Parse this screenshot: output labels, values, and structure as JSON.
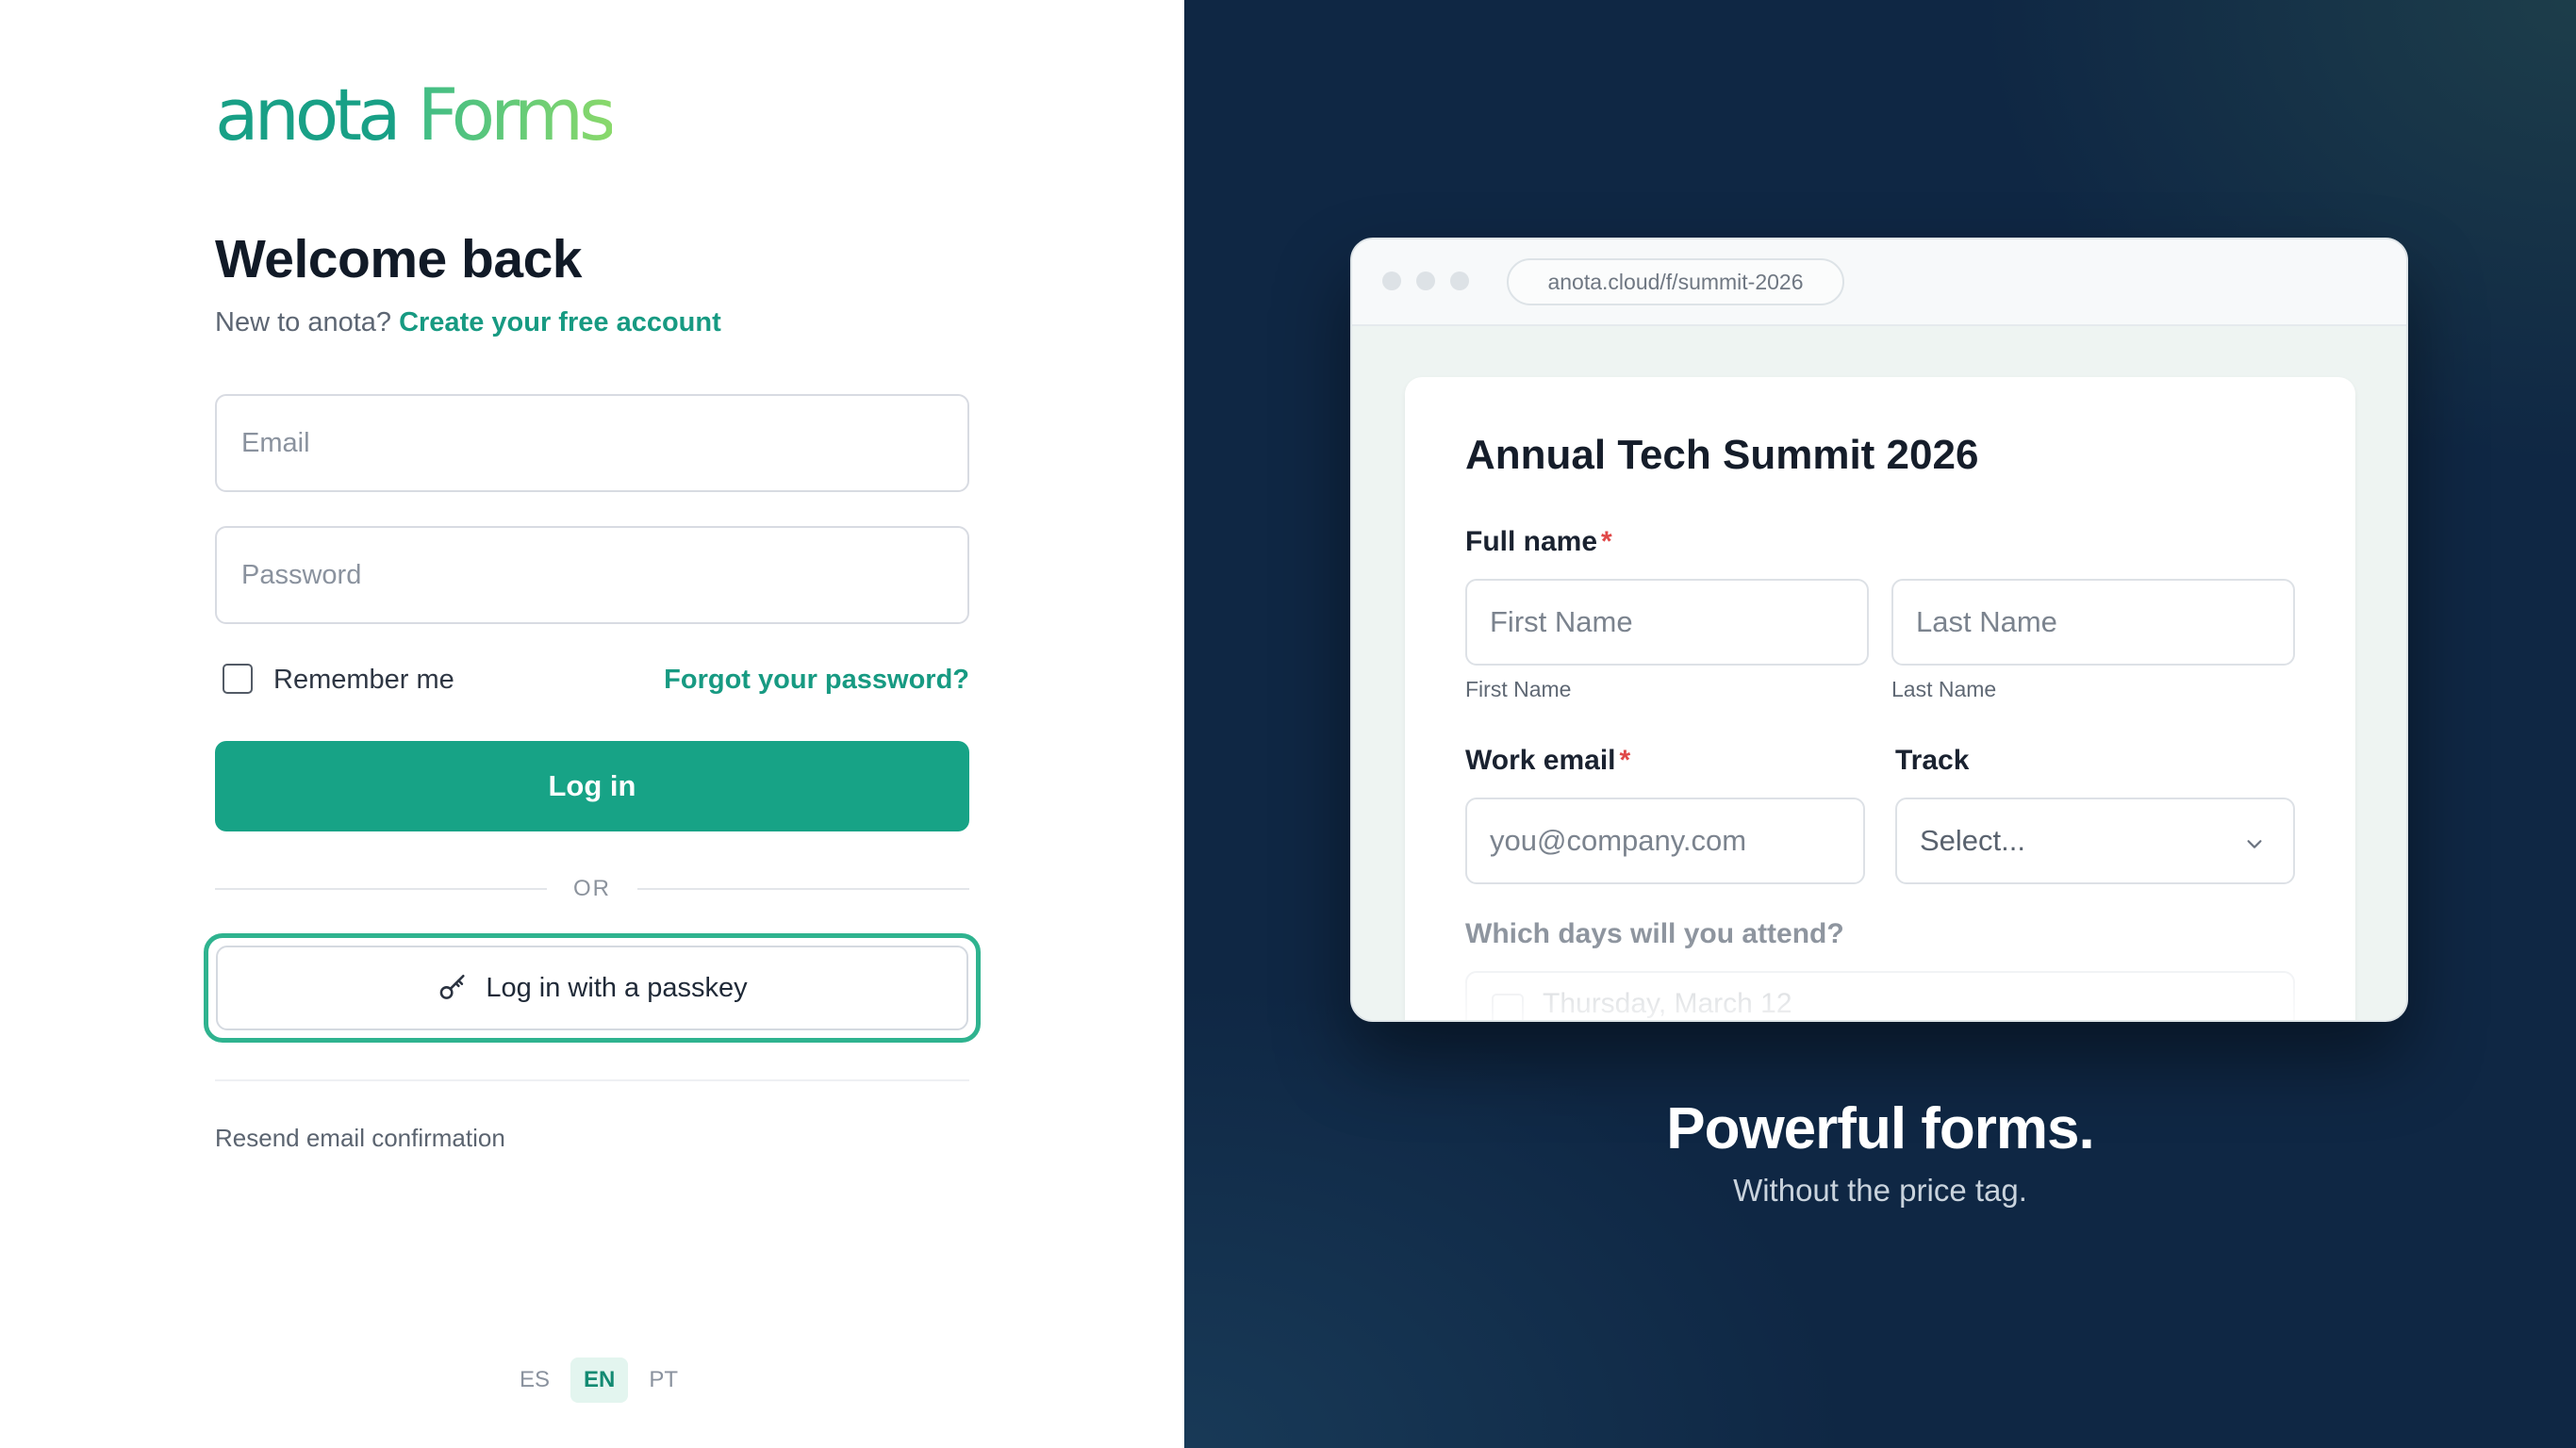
{
  "brand": {
    "word1": "anota",
    "word2": "Forms"
  },
  "login": {
    "heading": "Welcome back",
    "signup_prompt": "New to anota?",
    "signup_link": "Create your free account",
    "email_placeholder": "Email",
    "password_placeholder": "Password",
    "remember_label": "Remember me",
    "forgot_link": "Forgot your password?",
    "login_button": "Log in",
    "divider_text": "OR",
    "passkey_button": "Log in with a passkey",
    "resend_link": "Resend email confirmation"
  },
  "languages": [
    {
      "code": "ES",
      "active": false
    },
    {
      "code": "EN",
      "active": true
    },
    {
      "code": "PT",
      "active": false
    }
  ],
  "preview": {
    "url": "anota.cloud/f/summit-2026",
    "form_title": "Annual Tech Summit 2026",
    "full_name_label": "Full name",
    "required_mark": "*",
    "first_name_placeholder": "First Name",
    "last_name_placeholder": "Last Name",
    "first_name_sublabel": "First Name",
    "last_name_sublabel": "Last Name",
    "work_email_label": "Work email",
    "work_email_placeholder": "you@company.com",
    "track_label": "Track",
    "track_select": "Select...",
    "days_question": "Which days will you attend?",
    "day_option_1": "Thursday, March 12"
  },
  "marketing": {
    "tagline": "Powerful forms.",
    "subtagline": "Without the price tag."
  },
  "colors": {
    "primary": "#17a386",
    "link": "#179a82",
    "right_bg": "#0f2744",
    "required": "#e04848"
  },
  "icons": {
    "passkey": "key-icon",
    "track_dropdown": "chevron-down-icon"
  }
}
